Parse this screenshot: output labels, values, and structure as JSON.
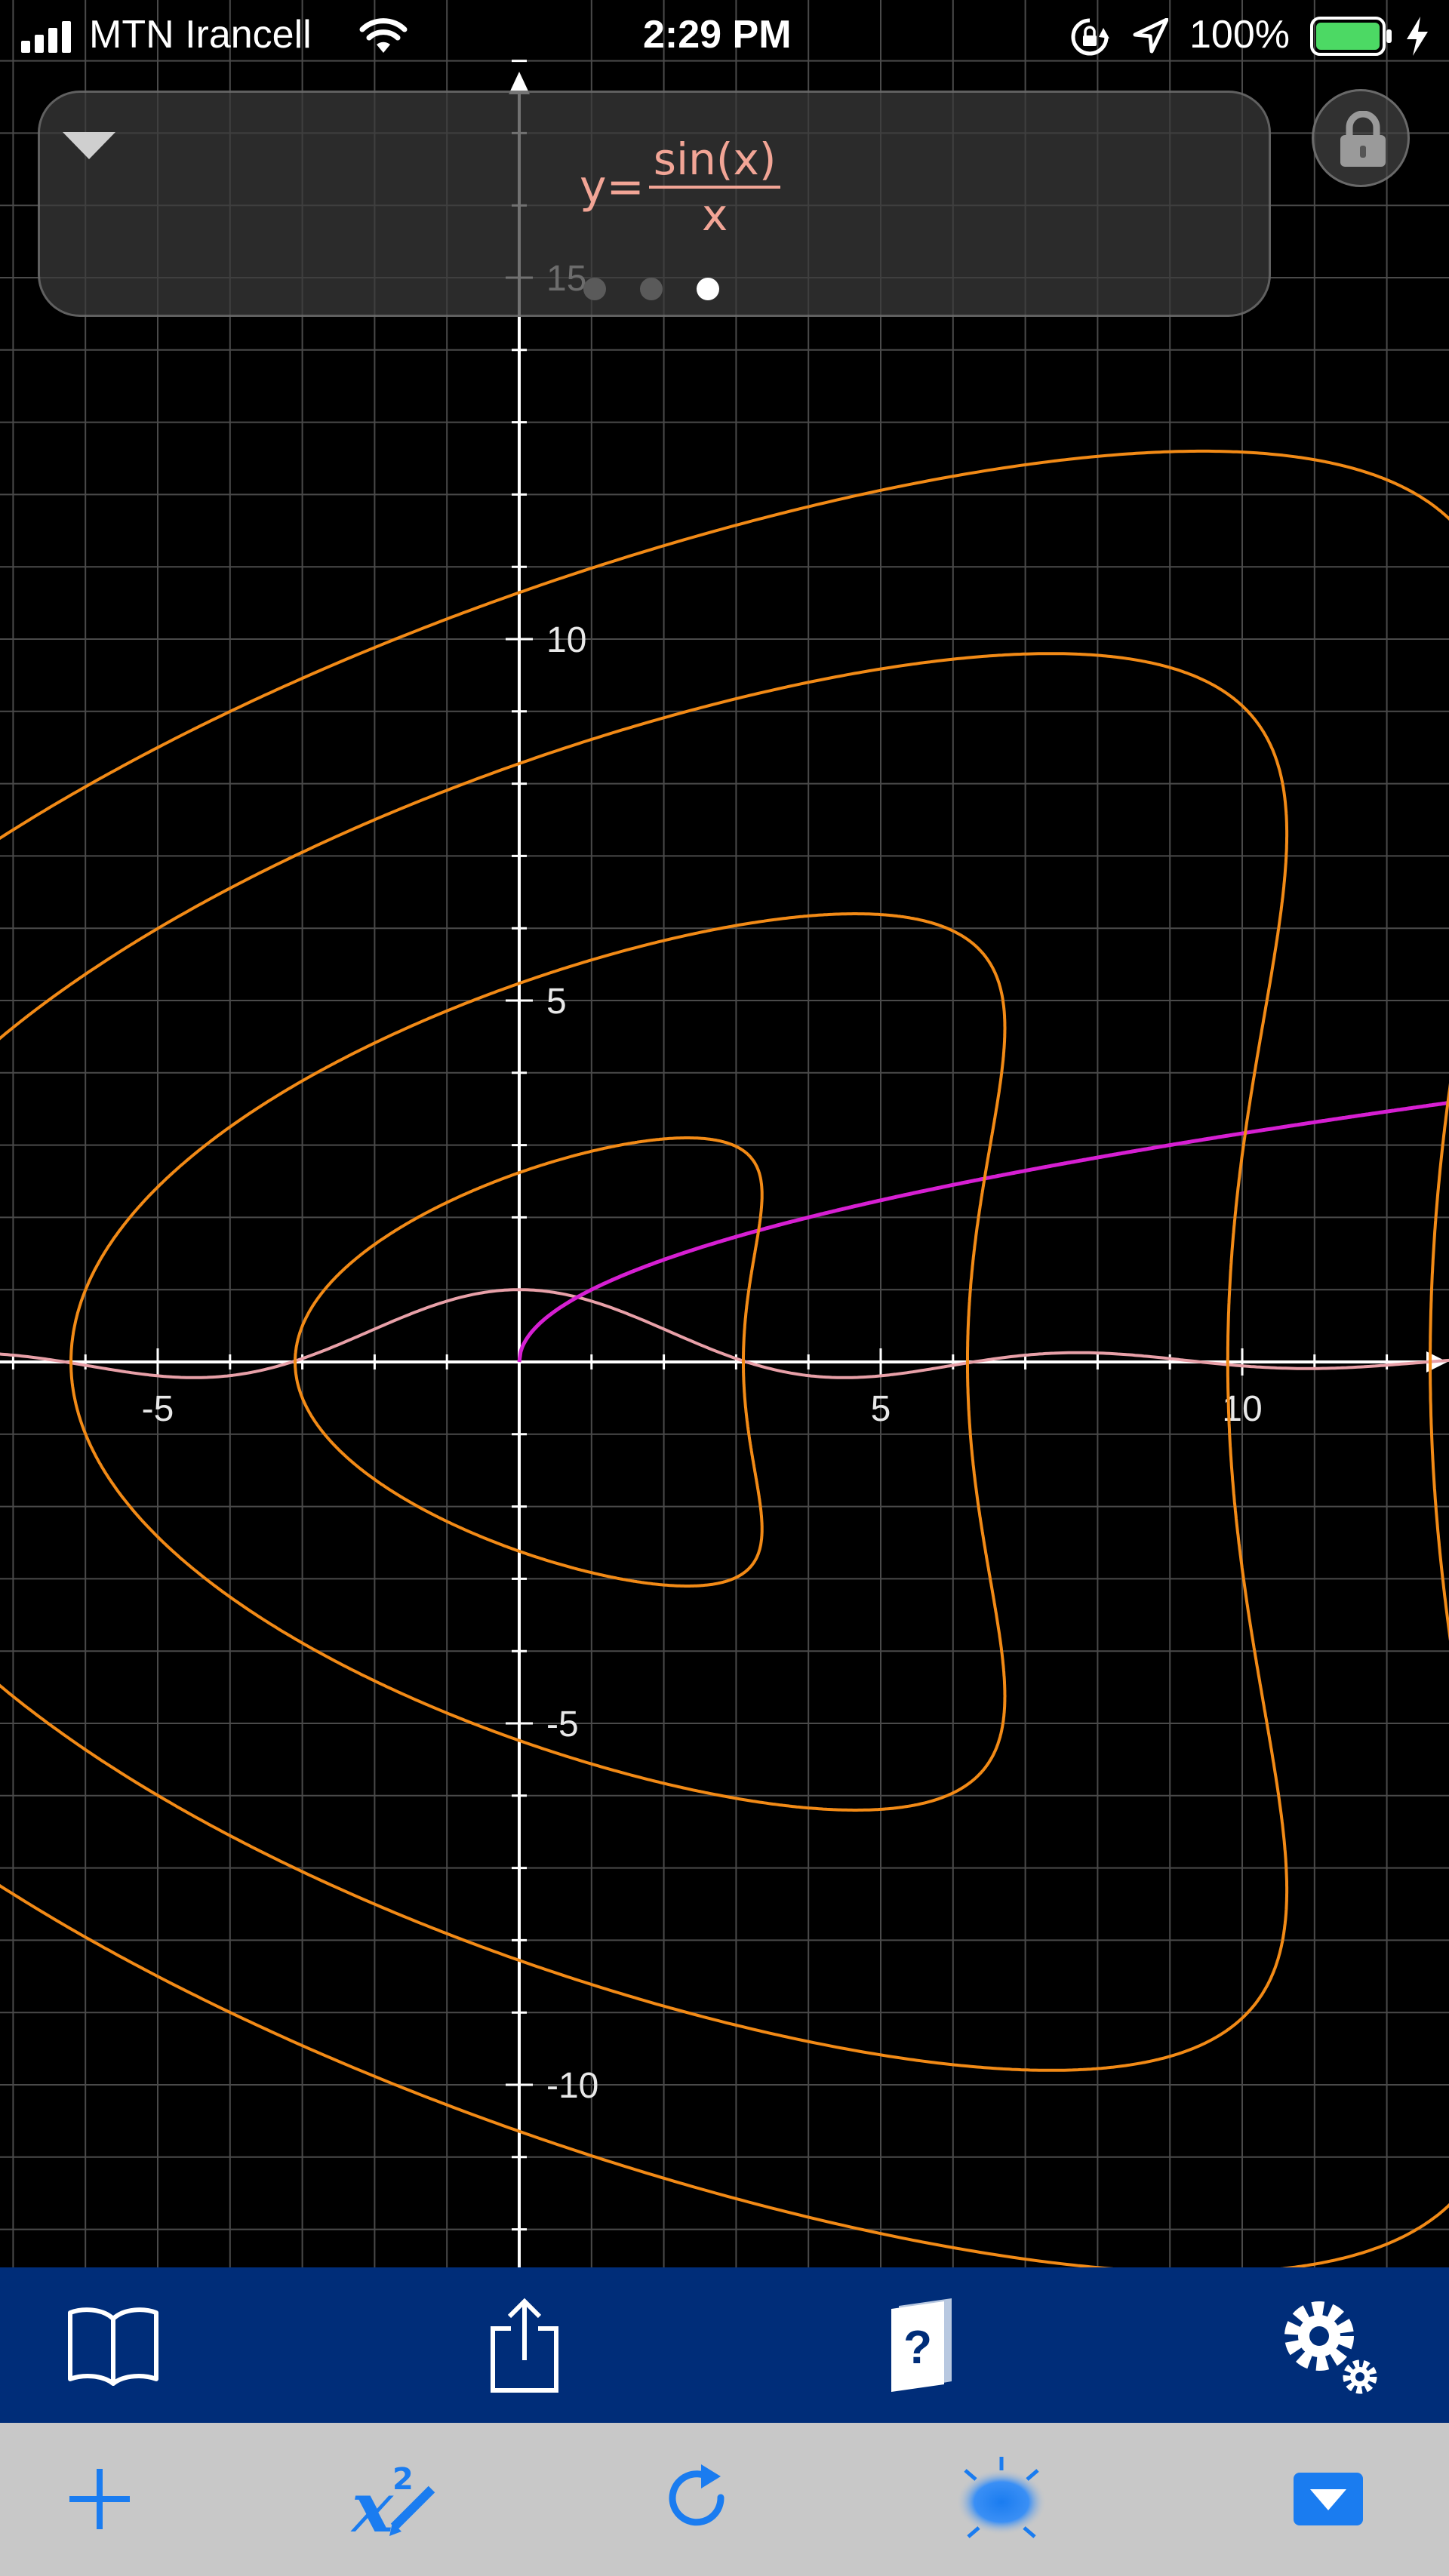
{
  "status": {
    "carrier": "MTN Irancell",
    "time": "2:29 PM",
    "battery_percent": "100%",
    "battery_level": 1.0,
    "icons": [
      "signal-bars-icon",
      "wifi-icon",
      "orientation-lock-icon",
      "location-arrow-icon",
      "battery-icon",
      "charging-bolt-icon"
    ]
  },
  "formula_card": {
    "lhs": "y=",
    "numerator": "sin(x)",
    "denominator": "x",
    "page_count": 3,
    "active_page": 2,
    "icons": [
      "collapse-triangle-icon"
    ]
  },
  "graph": {
    "x_tick_labels": [
      "-5",
      "5",
      "10"
    ],
    "y_tick_labels": [
      "15",
      "10",
      "5",
      "-5",
      "-10"
    ],
    "x_range": [
      -7.2,
      12.9
    ],
    "y_range": [
      -12.5,
      18.8
    ],
    "grid": true,
    "colors": {
      "sinc_curve": "#e8a0a8",
      "sqrt_curve": "#d61fd2",
      "crescent_curves": "#f28a16",
      "axes": "#ffffff",
      "grid": "#4a4a4a"
    }
  },
  "toolbar": {
    "background": "#002d79",
    "icons": [
      "book-icon",
      "share-icon",
      "help-book-icon",
      "settings-gears-icon"
    ]
  },
  "bottom_bar": {
    "background": "#c8c8c8",
    "accent": "#1a7cf0",
    "icons": [
      "plus-icon",
      "function-edit-icon",
      "redo-icon",
      "sun-icon",
      "dropdown-icon"
    ]
  },
  "lock_button": {
    "icon": "lock-icon"
  }
}
